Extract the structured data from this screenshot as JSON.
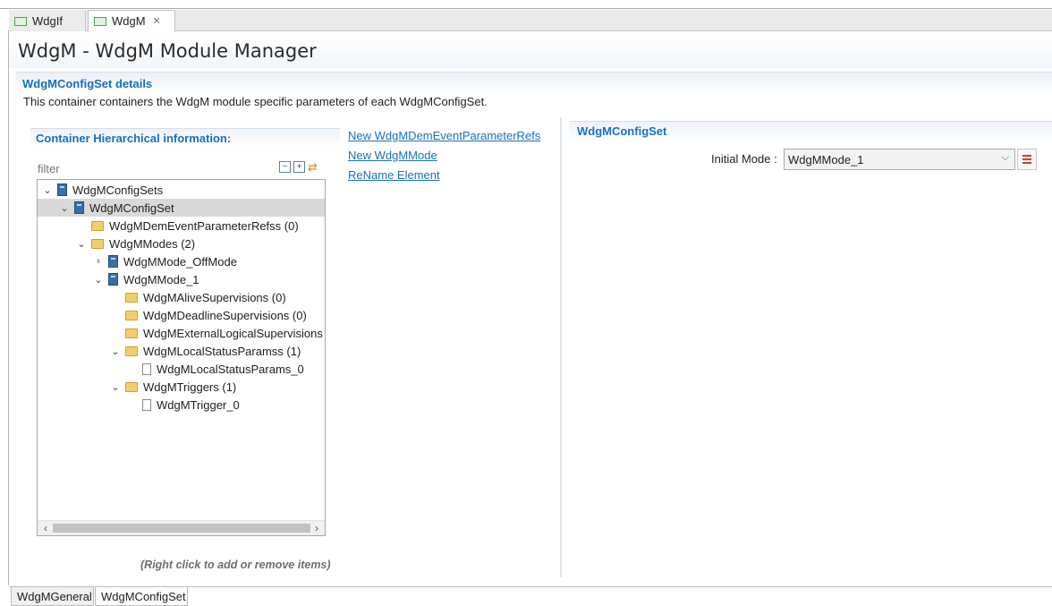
{
  "editor_tabs": [
    {
      "label": "WdgIf",
      "active": false
    },
    {
      "label": "WdgM",
      "active": true
    }
  ],
  "page": {
    "title": "WdgM - WdgM Module Manager"
  },
  "details": {
    "title": "WdgMConfigSet details",
    "description": "This container containers the WdgM module specific parameters of each WdgMConfigSet."
  },
  "hierarchy": {
    "title": "Container Hierarchical information:",
    "filter_placeholder": "filter",
    "hint": "(Right click to add or remove items)",
    "tree": [
      {
        "label": "WdgMConfigSets",
        "level": 0,
        "twisty": "expanded",
        "icon": "node"
      },
      {
        "label": "WdgMConfigSet",
        "level": 1,
        "twisty": "expanded",
        "icon": "node",
        "selected": true
      },
      {
        "label": "WdgMDemEventParameterRefss (0)",
        "level": 2,
        "twisty": "none",
        "icon": "folder"
      },
      {
        "label": "WdgMModes (2)",
        "level": 2,
        "twisty": "expanded",
        "icon": "folder"
      },
      {
        "label": "WdgMMode_OffMode",
        "level": 3,
        "twisty": "collapsed",
        "icon": "node"
      },
      {
        "label": "WdgMMode_1",
        "level": 3,
        "twisty": "expanded",
        "icon": "node"
      },
      {
        "label": "WdgMAliveSupervisions (0)",
        "level": 4,
        "twisty": "none",
        "icon": "folder"
      },
      {
        "label": "WdgMDeadlineSupervisions (0)",
        "level": 4,
        "twisty": "none",
        "icon": "folder"
      },
      {
        "label": "WdgMExternalLogicalSupervisions",
        "level": 4,
        "twisty": "none",
        "icon": "folder"
      },
      {
        "label": "WdgMLocalStatusParamss (1)",
        "level": 4,
        "twisty": "expanded",
        "icon": "folder"
      },
      {
        "label": "WdgMLocalStatusParams_0",
        "level": 5,
        "twisty": "none",
        "icon": "doc"
      },
      {
        "label": "WdgMTriggers (1)",
        "level": 4,
        "twisty": "expanded",
        "icon": "folder"
      },
      {
        "label": "WdgMTrigger_0",
        "level": 5,
        "twisty": "none",
        "icon": "doc"
      }
    ]
  },
  "actions": [
    {
      "label": "New WdgMDemEventParameterRefs"
    },
    {
      "label": "New WdgMMode"
    },
    {
      "label": "ReName Element"
    }
  ],
  "right_panel": {
    "title": "WdgMConfigSet",
    "initial_mode_label": "Initial Mode :",
    "initial_mode_value": "WdgMMode_1"
  },
  "bottom_tabs": [
    {
      "label": "WdgMGeneral",
      "active": false
    },
    {
      "label": "WdgMConfigSet",
      "active": true
    }
  ],
  "colors": {
    "accent": "#1a6fc0",
    "selection": "#d9d9d9"
  }
}
